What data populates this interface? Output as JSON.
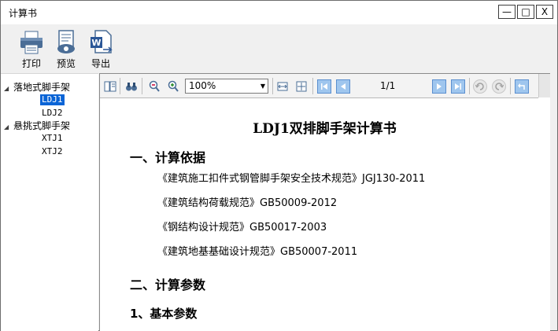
{
  "window": {
    "title": "计算书",
    "minimize": "—",
    "maximize": "□",
    "close": "X"
  },
  "toolbar": {
    "print_label": "打印",
    "preview_label": "预览",
    "export_label": "导出"
  },
  "tree": {
    "groups": [
      {
        "label": "落地式脚手架",
        "items": [
          "LDJ1",
          "LDJ2"
        ]
      },
      {
        "label": "悬挑式脚手架",
        "items": [
          "XTJ1",
          "XTJ2"
        ]
      }
    ],
    "selected": "LDJ1"
  },
  "viewer": {
    "zoom": "100%",
    "page_indicator": "1/1"
  },
  "document": {
    "title": "LDJ1双排脚手架计算书",
    "section1": "一、计算依据",
    "references": [
      "《建筑施工扣件式钢管脚手架安全技术规范》JGJ130-2011",
      "《建筑结构荷载规范》GB50009-2012",
      "《钢结构设计规范》GB50017-2003",
      "《建筑地基基础设计规范》GB50007-2011"
    ],
    "section2": "二、计算参数",
    "subsection1": "1、基本参数"
  },
  "colors": {
    "selection": "#0a64d6",
    "window_bg": "#f0f0f0"
  }
}
